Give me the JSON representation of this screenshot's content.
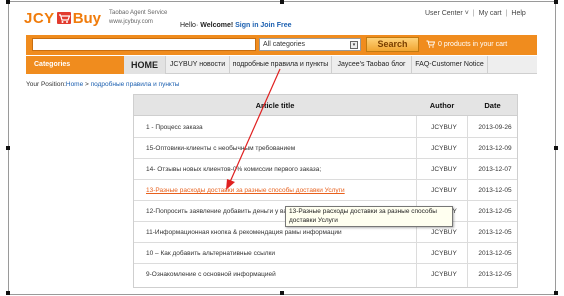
{
  "logo": {
    "part1": "JCY",
    "part2": "Buy"
  },
  "tagline": {
    "line1": "Taobao Agent Service",
    "line2": "www.jcybuy.com"
  },
  "greeting": {
    "hello": "Hello·",
    "welcome": "Welcome!",
    "signin": "Sign in Join Free"
  },
  "top_links": {
    "user_center": "User Center",
    "user_center_arrow": "˅",
    "sep": "|",
    "my_cart": "My cart",
    "help": "Help"
  },
  "search": {
    "query": "",
    "category": "All categories",
    "category_arrow": "▾",
    "button": "Search"
  },
  "cart": {
    "text": "0 products in your cart"
  },
  "nav": {
    "categories": "Categories",
    "items": [
      {
        "label": "HOME"
      },
      {
        "label": "JCYBUY новости"
      },
      {
        "label": "подробные правила и пункты"
      },
      {
        "label": "Jaycee's Taobao блог"
      },
      {
        "label": "FAQ-Customer Notice"
      }
    ]
  },
  "breadcrumb": {
    "prefix": "Your Position:",
    "home": "Home",
    "sep": " > ",
    "current": "подробные правила и пункты"
  },
  "table": {
    "headers": {
      "title": "Article title",
      "author": "Author",
      "date": "Date"
    },
    "rows": [
      {
        "title": "1 - Процесс заказа",
        "author": "JCYBUY",
        "date": "2013-09-26"
      },
      {
        "title": "15-Оптовики-клиенты с необычным требованием",
        "author": "JCYBUY",
        "date": "2013-12-09"
      },
      {
        "title": "14- Отзывы новых клиентов-0% комиссии первого заказа;",
        "author": "JCYBUY",
        "date": "2013-12-07"
      },
      {
        "title": "13-Разные расходы доставки за разные способы доставки Услуги",
        "author": "JCYBUY",
        "date": "2013-12-05"
      },
      {
        "title": "12-Попросить заявление добавить деньги у ваш",
        "author": "JCYBUY",
        "date": "2013-12-05"
      },
      {
        "title": "11-Информационная кнопка & рекомендация рамы информации",
        "author": "JCYBUY",
        "date": "2013-12-05"
      },
      {
        "title": "10 – Как добавить альтернативные ссылки",
        "author": "JCYBUY",
        "date": "2013-12-05"
      },
      {
        "title": "9-Ознакомление с основной информацией",
        "author": "JCYBUY",
        "date": "2013-12-05"
      }
    ]
  },
  "tooltip": {
    "line1": "13-Разные расходы доставки за разные способы",
    "line2": "доставки Услуги"
  },
  "colors": {
    "accent": "#f08c1e",
    "link": "#1b5fb0",
    "hover_link": "#e8601c",
    "annotation": "#e02020"
  }
}
